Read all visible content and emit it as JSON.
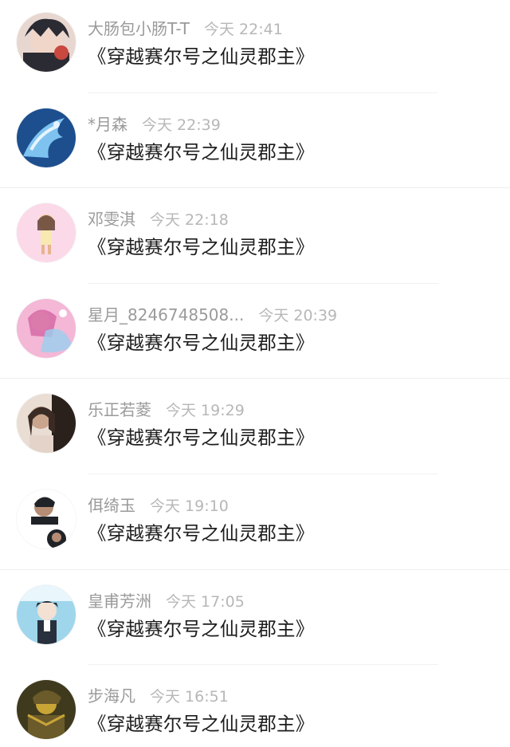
{
  "comments": [
    {
      "user": "大肠包小肠T-T",
      "time": "今天 22:41",
      "text": "《穿越赛尔号之仙灵郡主》",
      "avatar_colors": [
        "#2b2b33",
        "#c9483f",
        "#e8d7d0"
      ],
      "avatar_icon": "anime-boy-avatar-icon"
    },
    {
      "user": "*月森",
      "time": "今天 22:39",
      "text": "《穿越赛尔号之仙灵郡主》",
      "avatar_colors": [
        "#1d4f8f",
        "#7ec3f0",
        "#e6f4ff"
      ],
      "avatar_icon": "blue-dragon-avatar-icon"
    },
    {
      "user": "邓雯淇",
      "time": "今天 22:18",
      "text": "《穿越赛尔号之仙灵郡主》",
      "avatar_colors": [
        "#fbd9e8",
        "#f3c8a0",
        "#5a3b2e"
      ],
      "avatar_icon": "cartoon-girl-avatar-icon"
    },
    {
      "user": "星月_8246748508...",
      "time": "今天 20:39",
      "text": "《穿越赛尔号之仙灵郡主》",
      "avatar_colors": [
        "#f4b7d6",
        "#9ad0ef",
        "#d66aa6"
      ],
      "avatar_icon": "fairy-girl-avatar-icon"
    },
    {
      "user": "乐正若菱",
      "time": "今天 19:29",
      "text": "《穿越赛尔号之仙灵郡主》",
      "avatar_colors": [
        "#e9ddd4",
        "#2a211d",
        "#caa58e"
      ],
      "avatar_icon": "girl-photo-avatar-icon"
    },
    {
      "user": "佴绮玉",
      "time": "今天 19:10",
      "text": "《穿越赛尔号之仙灵郡主》",
      "avatar_colors": [
        "#ffffff",
        "#1f2328",
        "#b58c74"
      ],
      "avatar_icon": "boy-collage-avatar-icon"
    },
    {
      "user": "皇甫芳洲",
      "time": "今天 17:05",
      "text": "《穿越赛尔号之仙灵郡主》",
      "avatar_colors": [
        "#9fd6ec",
        "#27303c",
        "#e9f6fb"
      ],
      "avatar_icon": "anime-student-avatar-icon"
    },
    {
      "user": "步海凡",
      "time": "今天 16:51",
      "text": "《穿越赛尔号之仙灵郡主》",
      "avatar_colors": [
        "#3f3a1d",
        "#c9a536",
        "#6b5a2a"
      ],
      "avatar_icon": "warrior-avatar-icon"
    }
  ]
}
